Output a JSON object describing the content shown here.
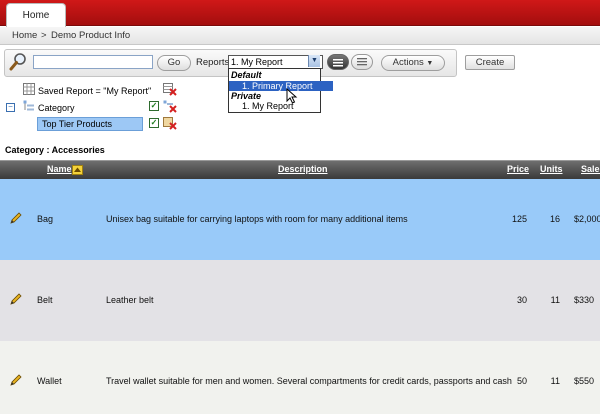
{
  "nav": {
    "home_tab": "Home"
  },
  "breadcrumb": {
    "home": "Home",
    "separator": ">",
    "current": "Demo Product Info"
  },
  "search": {
    "input_value": "",
    "go_label": "Go",
    "reports_label": "Reports",
    "reports_selected": "1. My Report",
    "actions_label": "Actions",
    "create_label": "Create"
  },
  "dropdown": {
    "group_default": "Default",
    "option_primary": "1. Primary Report",
    "group_private": "Private",
    "option_my": "1. My Report"
  },
  "filters": {
    "saved_report": "Saved Report = \"My Report\"",
    "category": "Category",
    "top_tier": "Top Tier Products"
  },
  "group_heading": "Category : Accessories",
  "table": {
    "columns": {
      "name": "Name",
      "description": "Description",
      "price": "Price",
      "units": "Units",
      "sales": "Sales"
    },
    "rows": [
      {
        "name": "Bag",
        "description": "Unisex bag suitable for carrying laptops with room for many additional items",
        "price": "125",
        "units": "16",
        "sales": "$2,000"
      },
      {
        "name": "Belt",
        "description": "Leather belt",
        "price": "30",
        "units": "11",
        "sales": "$330"
      },
      {
        "name": "Wallet",
        "description": "Travel wallet suitable for men and women. Several compartments for credit cards, passports and cash",
        "price": "50",
        "units": "11",
        "sales": "$550"
      }
    ]
  },
  "colors": {
    "topbar": "#c01414",
    "highlight_row": "#99caf9",
    "alt_row": "#e3e2e6",
    "plain_row": "#f1f2ee"
  }
}
